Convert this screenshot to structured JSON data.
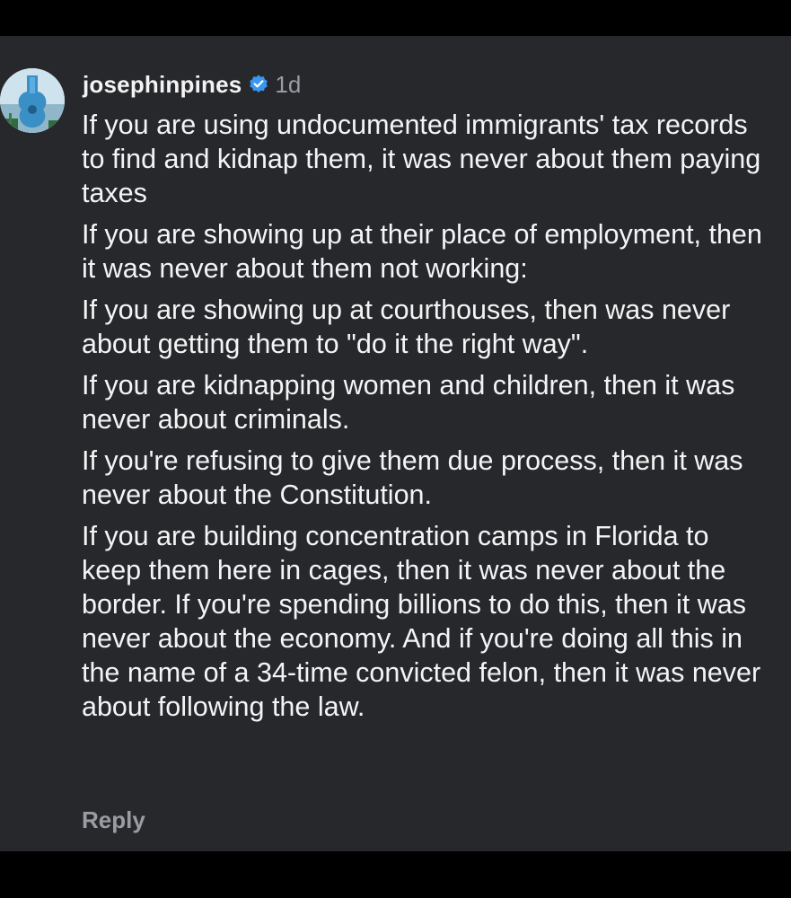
{
  "comment": {
    "username": "josephinpines",
    "timestamp": "1d",
    "paragraphs": [
      "If you are using undocumented immigrants' tax records to find and kidnap them, it was never about them paying taxes",
      "If you are showing up at their place of employment, then it was never about them not working:",
      "If you are showing up at courthouses, then was never about getting them to \"do it the right way\".",
      "If you are kidnapping women and children, then it was never about criminals.",
      "If you're refusing to give them due process, then it was never about the Constitution.",
      "If you are building concentration camps in Florida to keep them here in cages, then it was never about the border. If you're spending billions to do this, then it was never about the economy. And if you're doing all this in the name of a 34-time convicted felon, then it was never about following the law."
    ],
    "reply_label": "Reply"
  },
  "colors": {
    "background": "#000000",
    "panel": "#27282c",
    "text": "#f4f4f4",
    "muted": "#9a9ca1",
    "verified_badge": "#3897f0"
  },
  "icons": {
    "avatar": "guitar-building-avatar",
    "verified": "verified-badge-icon"
  }
}
